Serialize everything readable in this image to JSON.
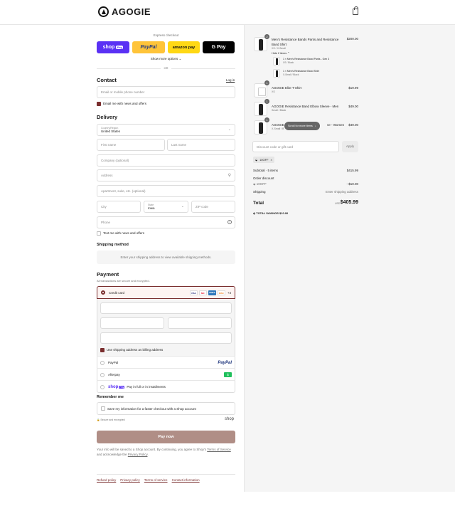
{
  "header": {
    "brand": "AGOGIE",
    "cart_icon": "shopping-bag-icon"
  },
  "express": {
    "label": "Express checkout",
    "buttons": {
      "shop": "shop",
      "shop_badge": "Pay",
      "paypal": "PayPal",
      "amazon": "amazon pay",
      "gpay": "G Pay"
    },
    "more": "Show more options",
    "or": "OR"
  },
  "contact": {
    "heading": "Contact",
    "login": "Log in",
    "email_placeholder": "Email or mobile phone number",
    "news": "Email me with news and offers"
  },
  "delivery": {
    "heading": "Delivery",
    "country_label": "Country/Region",
    "country_value": "United States",
    "first_name": "First name",
    "last_name": "Last name",
    "company": "Company (optional)",
    "address": "Address",
    "apartment": "Apartment, suite, etc. (optional)",
    "city": "City",
    "state_label": "State",
    "state_value": "Iowa",
    "zip": "ZIP code",
    "phone": "Phone",
    "text_news": "Text me with news and offers"
  },
  "shipping": {
    "heading": "Shipping method",
    "notice": "Enter your shipping address to view available shipping methods."
  },
  "payment": {
    "heading": "Payment",
    "secure": "All transactions are secure and encrypted.",
    "credit_card": "Credit card",
    "card_brands": [
      "VISA",
      "MC",
      "AMEX",
      "DISC"
    ],
    "more_cards": "+4",
    "billing_same": "Use shipping address as billing address",
    "paypal": "PayPal",
    "paypal_logo": "PayPal",
    "afterpay": "Afterpay",
    "afterpay_logo": "$",
    "shoppay_logo": "shop",
    "shoppay_badge": "Pay",
    "shoppay_text": "Pay in full or in installments"
  },
  "remember": {
    "heading": "Remember me",
    "save": "Save my information for a faster checkout with a Shop account",
    "secure": "Secure and encrypted",
    "shop": "shop"
  },
  "pay_button": "Pay now",
  "consent": {
    "before": "Your info will be saved to a Shop account. By continuing, you agree to Shop's ",
    "terms": "Terms of Service",
    "mid": " and acknowledge the ",
    "privacy": "Privacy Policy",
    "after": "."
  },
  "footer": {
    "links": [
      "Refund policy",
      "Privacy policy",
      "Terms of service",
      "Contact information"
    ]
  },
  "cart": {
    "items": [
      {
        "qty": "2",
        "title1": "Men's Resistance Bands Pants and Resistance",
        "title2": "Band Shirt",
        "variant": "XS / X-Small",
        "price": "$200.00",
        "toggle": "Hide 2 items",
        "sub": [
          {
            "title": "1 × Men's Resistance Band Pants - Gen 3",
            "variant": "XS / Black"
          },
          {
            "title": "1 × Men's Resistance Band Shirt",
            "variant": "X-Small / Black"
          }
        ]
      },
      {
        "qty": "1",
        "title1": "AGOGIE Elite T-Shirt",
        "variant": "XS",
        "price": "$19.99"
      },
      {
        "qty": "1",
        "title1": "AGOGIE Resistance Band Elbow Sleeve - Men",
        "variant": "Small / Black",
        "price": "$49.00"
      },
      {
        "qty": "1",
        "title1": "AGOGIE",
        "title_tail": "ve - Women",
        "variant": "X-Small / B",
        "price": "$49.00"
      }
    ],
    "scroll_pill": "Scroll for more items",
    "discount_placeholder": "Discount code or gift card",
    "apply": "Apply",
    "code_tag": "10OFF",
    "subtotal_label": "Subtotal · 5 items",
    "subtotal": "$415.99",
    "order_discount": "Order discount",
    "discount_code": "10OFF",
    "discount_value": "- $10.00",
    "shipping_label": "Shipping",
    "shipping_value": "Enter shipping address",
    "total_label": "Total",
    "currency": "USD",
    "total": "$405.99",
    "savings_label": "TOTAL SAVINGS",
    "savings": "$10.00"
  }
}
